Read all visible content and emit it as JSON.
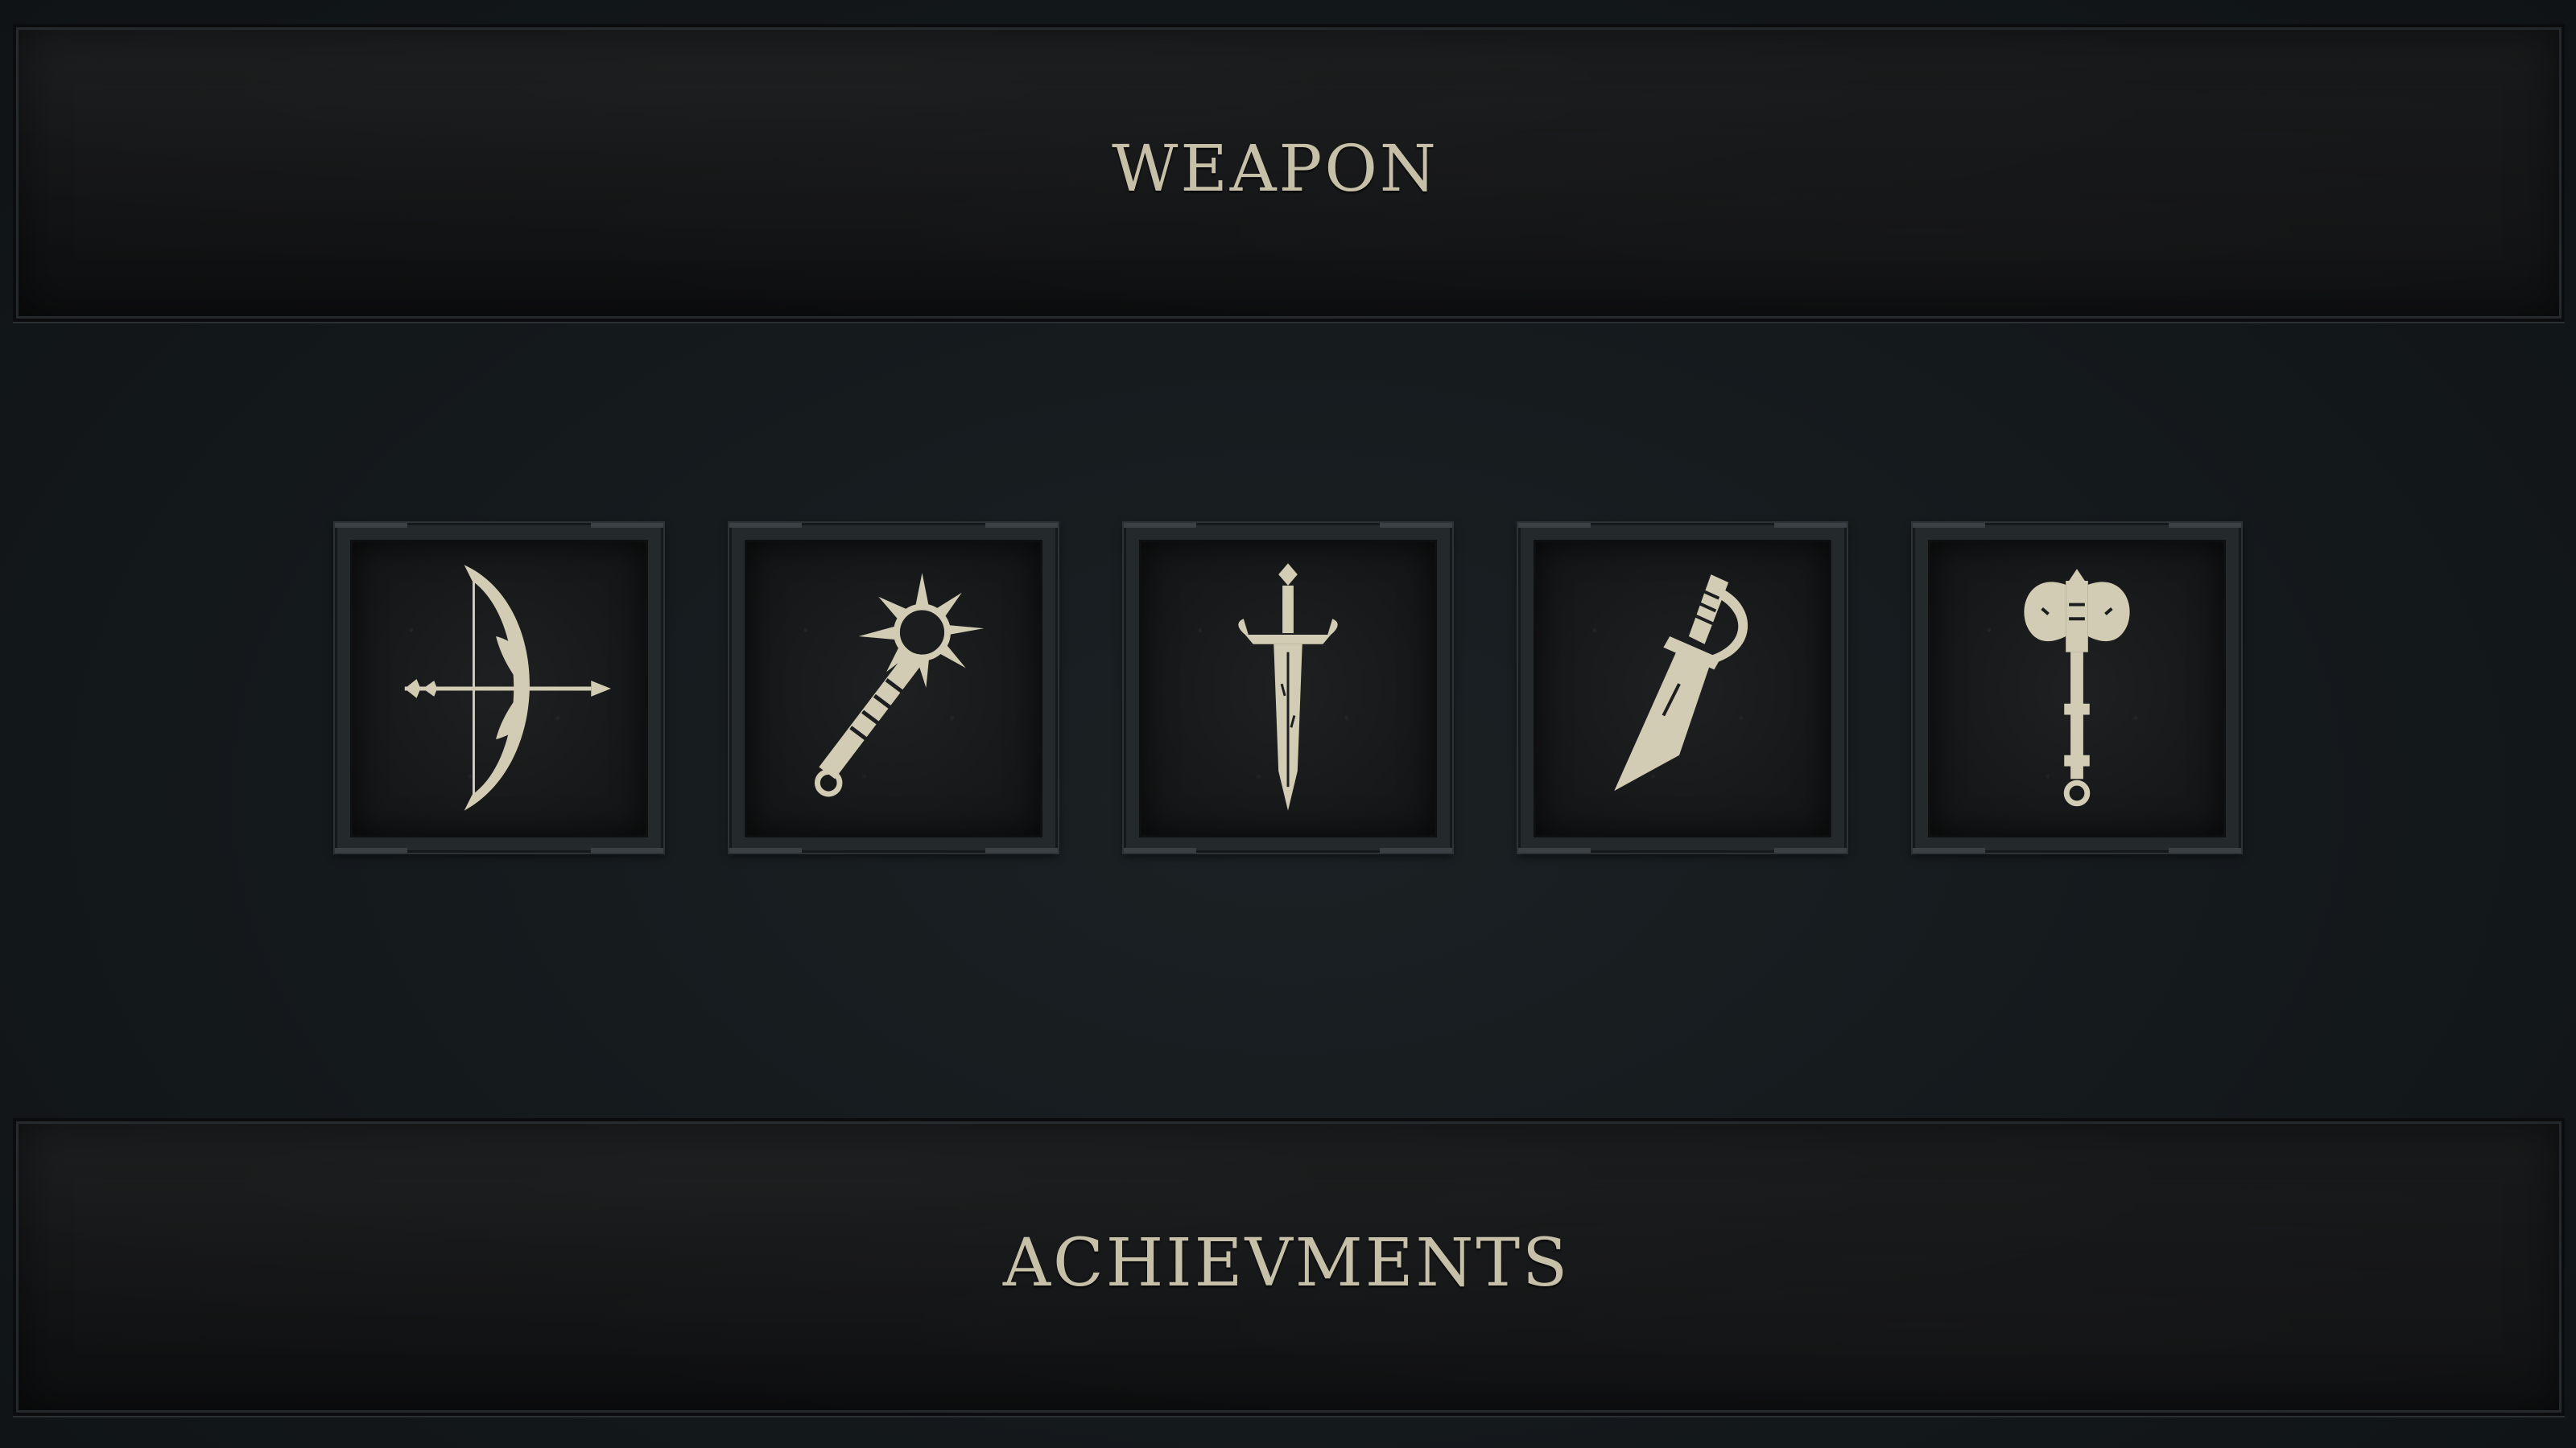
{
  "header": {
    "title": "WEAPON"
  },
  "weapon_slots": [
    {
      "icon": "bow-icon"
    },
    {
      "icon": "mace-icon"
    },
    {
      "icon": "sword-icon"
    },
    {
      "icon": "dagger-icon"
    },
    {
      "icon": "battle-axe-icon"
    }
  ],
  "footer": {
    "title": "ACHIEVMENTS"
  },
  "colors": {
    "icon_fill": "#d2ccb4",
    "title_text": "#c6c0a8",
    "background": "#14191c"
  }
}
